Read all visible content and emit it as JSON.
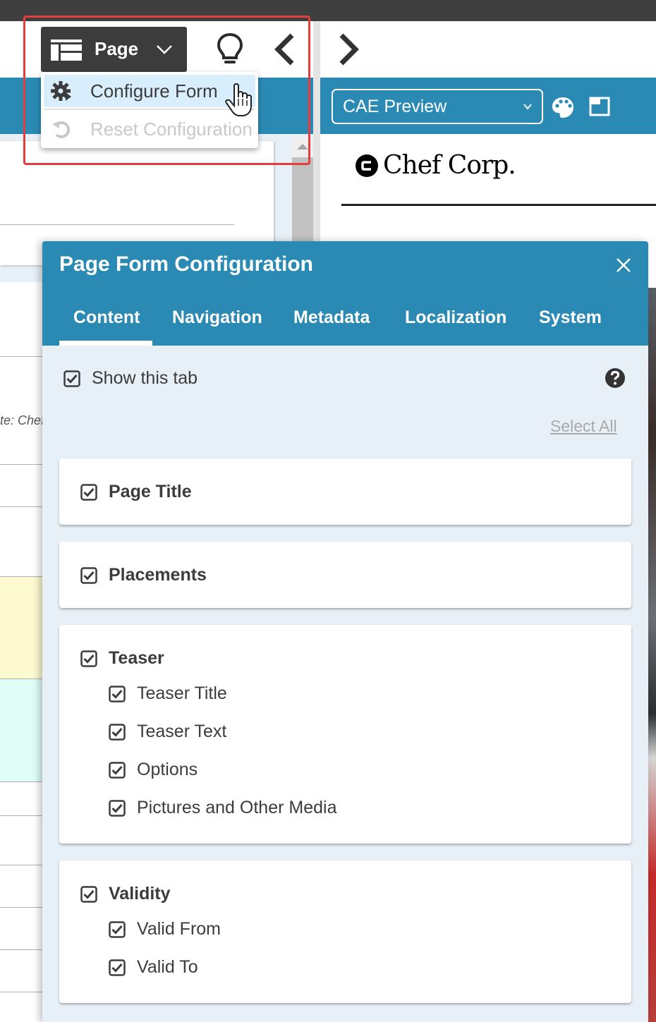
{
  "toolbar": {
    "page_button_label": "Page",
    "icons": [
      "layout-icon",
      "chevron-down-icon",
      "lightbulb-icon",
      "chevron-left-icon",
      "chevron-right-icon"
    ]
  },
  "dropdown_menu": {
    "items": [
      {
        "label": "Configure Form",
        "icon": "gear-icon",
        "state": "hovered"
      },
      {
        "label": "Reset Configuration",
        "icon": "reset-icon",
        "state": "disabled"
      }
    ]
  },
  "left_panel": {
    "note_text": "te: Chef"
  },
  "preview": {
    "select_value": "CAE Preview",
    "brand_name": "Chef Corp."
  },
  "modal": {
    "title": "Page Form Configuration",
    "tabs": [
      {
        "label": "Content",
        "active": true
      },
      {
        "label": "Navigation",
        "active": false
      },
      {
        "label": "Metadata",
        "active": false
      },
      {
        "label": "Localization",
        "active": false
      },
      {
        "label": "System",
        "active": false
      }
    ],
    "show_tab_label": "Show this tab",
    "show_tab_checked": true,
    "select_all_label": "Select All",
    "groups": [
      {
        "label": "Page Title",
        "checked": true,
        "items": []
      },
      {
        "label": "Placements",
        "checked": true,
        "items": []
      },
      {
        "label": "Teaser",
        "checked": true,
        "items": [
          {
            "label": "Teaser Title",
            "checked": true
          },
          {
            "label": "Teaser Text",
            "checked": true
          },
          {
            "label": "Options",
            "checked": true
          },
          {
            "label": "Pictures and Other Media",
            "checked": true
          }
        ]
      },
      {
        "label": "Validity",
        "checked": true,
        "items": [
          {
            "label": "Valid From",
            "checked": true
          },
          {
            "label": "Valid To",
            "checked": true
          }
        ]
      }
    ]
  },
  "colors": {
    "accent_blue": "#2a8ab4",
    "dark_button": "#3c3c3c",
    "menu_hover": "#d8eefc",
    "highlight_frame": "#e53c3c",
    "panel_bg": "#e8f0f7"
  }
}
